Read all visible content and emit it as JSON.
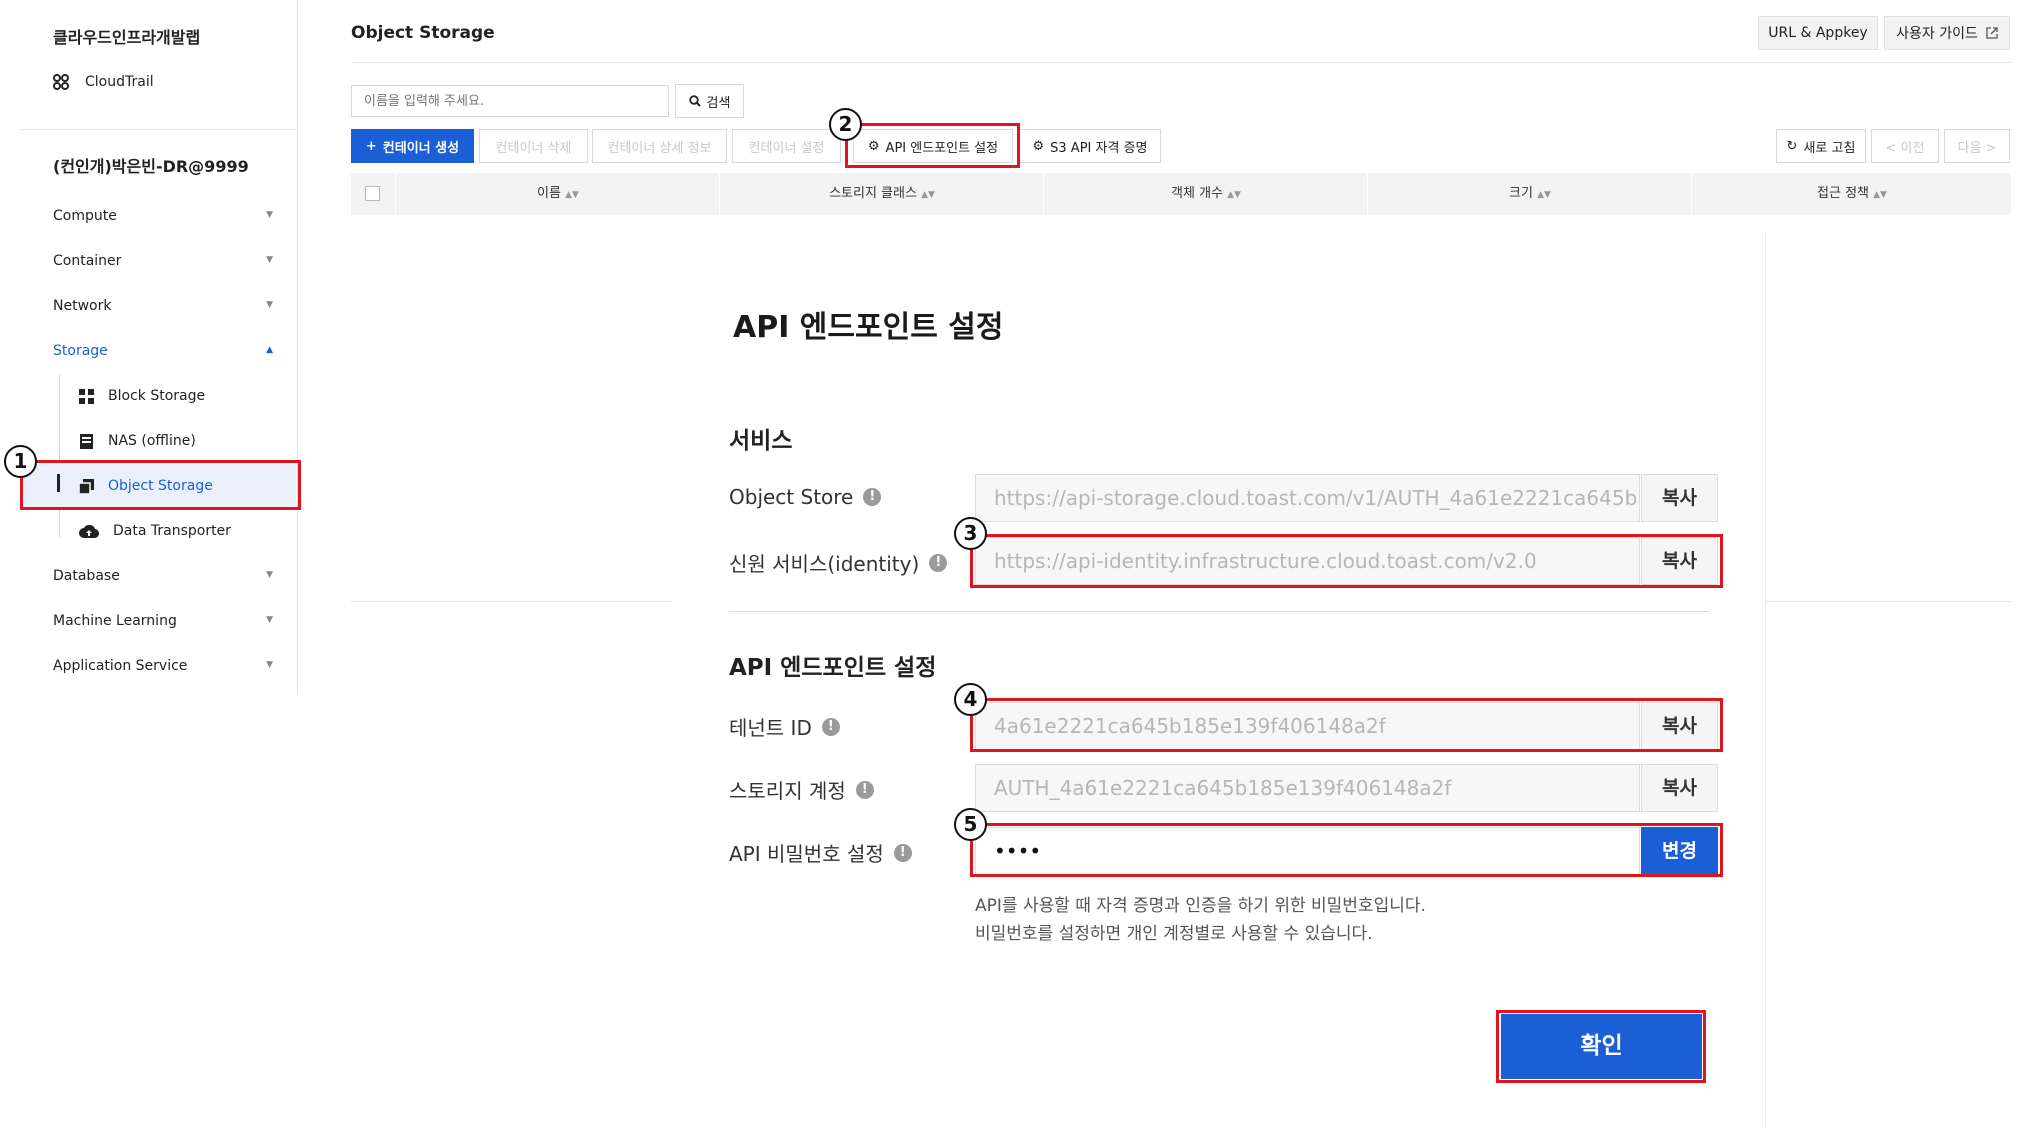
{
  "sidebar": {
    "project": "클라우드인프라개발랩",
    "cloudtrail": "CloudTrail",
    "org": "(컨인개)박은빈-DR@9999",
    "menu": {
      "compute": "Compute",
      "container": "Container",
      "network": "Network",
      "storage": "Storage",
      "database": "Database",
      "machine_learning": "Machine Learning",
      "application_service": "Application Service"
    },
    "storage_sub": {
      "block": "Block Storage",
      "nas": "NAS (offline)",
      "object": "Object Storage",
      "transporter": "Data Transporter"
    }
  },
  "header": {
    "title": "Object Storage",
    "url_appkey": "URL & Appkey",
    "user_guide": "사용자 가이드"
  },
  "toolbar": {
    "search_placeholder": "이름을 입력해 주세요.",
    "search_label": "검색",
    "create": "컨테이너 생성",
    "delete": "컨테이너 삭제",
    "details": "컨테이너 상세 정보",
    "settings": "컨테이너 설정",
    "api_endpoint": "API 엔드포인트 설정",
    "s3_credential": "S3 API 자격 증명",
    "refresh": "새로 고침",
    "prev": "< 이전",
    "next": "다음 >"
  },
  "table": {
    "columns": [
      "이름",
      "스토리지 클래스",
      "객체 개수",
      "크기",
      "접근 정책"
    ]
  },
  "modal": {
    "title": "API 엔드포인트 설정",
    "service_section": "서비스",
    "object_store_label": "Object Store",
    "object_store_url": "https://api-storage.cloud.toast.com/v1/AUTH_4a61e2221ca645b",
    "identity_label": "신원 서비스(identity)",
    "identity_url": "https://api-identity.infrastructure.cloud.toast.com/v2.0",
    "copy": "복사",
    "endpoint_section": "API 엔드포인트 설정",
    "tenant_label": "테넌트 ID",
    "tenant_id": "4a61e2221ca645b185e139f406148a2f",
    "account_label": "스토리지 계정",
    "account": "AUTH_4a61e2221ca645b185e139f406148a2f",
    "password_label": "API 비밀번호 설정",
    "password": "••••",
    "change": "변경",
    "help1": "API를 사용할 때 자격 증명과 인증을 하기 위한 비밀번호입니다.",
    "help2": "비밀번호를 설정하면 개인 계정별로 사용할 수 있습니다.",
    "confirm": "확인"
  },
  "callouts": [
    "1",
    "2",
    "3",
    "4",
    "5"
  ],
  "colors": {
    "accent": "#1a5fd6",
    "highlight": "#e0141e"
  }
}
